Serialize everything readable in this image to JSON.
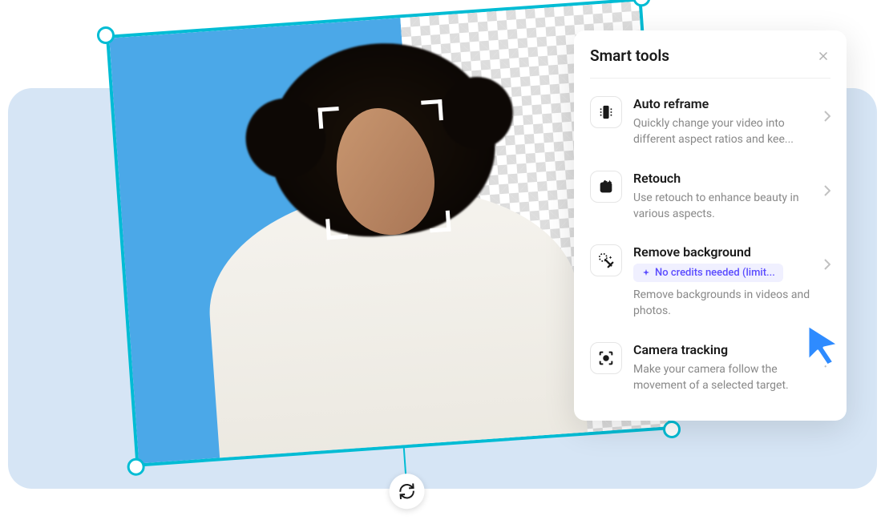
{
  "panel": {
    "title": "Smart tools",
    "tools": [
      {
        "title": "Auto reframe",
        "description": "Quickly change your video into different aspect ratios and kee..."
      },
      {
        "title": "Retouch",
        "description": "Use retouch to enhance beauty in various aspects."
      },
      {
        "title": "Remove background",
        "badge": "No credits needed (limit...",
        "description": "Remove backgrounds in videos and photos."
      },
      {
        "title": "Camera tracking",
        "description": "Make your camera follow the movement of a selected target."
      }
    ]
  },
  "colors": {
    "selection": "#00bcd4",
    "accent": "#5b4cff"
  }
}
